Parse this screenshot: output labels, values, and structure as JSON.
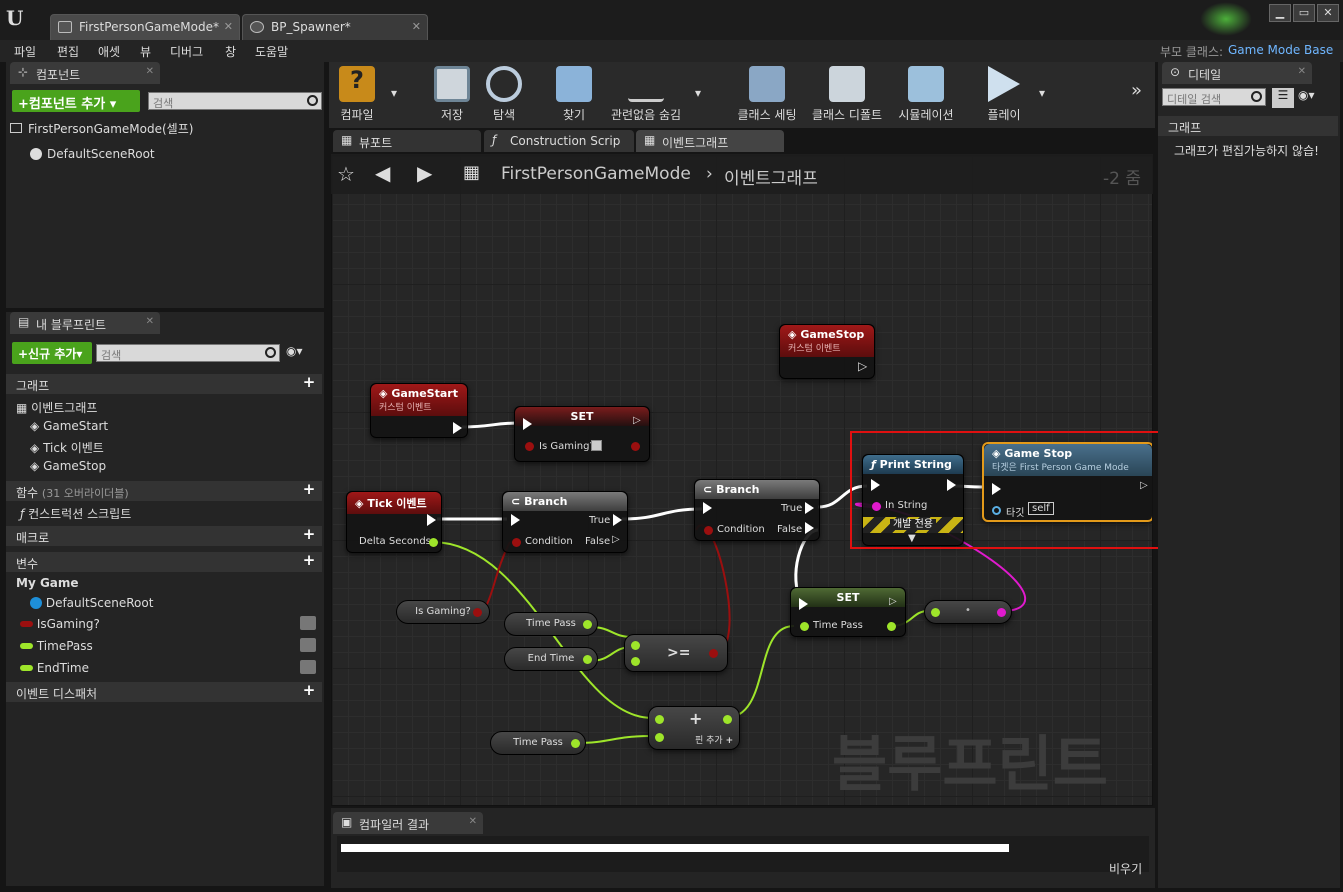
{
  "titlebar": {
    "tabs": [
      "FirstPersonGameMode*",
      "BP_Spawner*"
    ]
  },
  "menu": [
    "파일",
    "편집",
    "애셋",
    "뷰",
    "디버그",
    "창",
    "도움말"
  ],
  "parent_class": {
    "label": "부모 클래스:",
    "value": "Game Mode Base"
  },
  "components": {
    "tab": "컴포넌트",
    "add_button": "+컴포넌트 추가",
    "search_placeholder": "검색",
    "root": "FirstPersonGameMode(셀프)",
    "child": "DefaultSceneRoot"
  },
  "myblueprint": {
    "tab": "내 블루프린트",
    "add_button": "+신규 추가",
    "search_placeholder": "검색",
    "graph_section": "그래프",
    "graph_name": "이벤트그래프",
    "events": [
      "GameStart",
      "Tick 이벤트",
      "GameStop"
    ],
    "functions_section": "함수",
    "functions_count": "(31 오버라이더블)",
    "construction": "컨스트럭션 스크립트",
    "macros": "매크로",
    "variables": "변수",
    "category": "My Game",
    "vars": [
      "DefaultSceneRoot",
      "IsGaming?",
      "TimePass",
      "EndTime"
    ],
    "dispatchers": "이벤트 디스패처"
  },
  "toolbar": [
    "컴파일",
    "저장",
    "탐색",
    "찾기",
    "관련없음 숨김",
    "클래스 세팅",
    "클래스 디폴트",
    "시뮬레이션",
    "플레이"
  ],
  "graphtabs": [
    "뷰포트",
    "Construction Scrip",
    "이벤트그래프"
  ],
  "breadcrumb": {
    "bp": "FirstPersonGameMode",
    "graph": "이벤트그래프",
    "zoom": "-2 줌"
  },
  "nodes": {
    "gamestop_event": {
      "title": "GameStop",
      "sub": "커스텀 이벤트"
    },
    "gamestart_event": {
      "title": "GameStart",
      "sub": "커스텀 이벤트"
    },
    "set1": {
      "title": "SET",
      "pin": "Is Gaming?"
    },
    "tick": {
      "title": "Tick 이벤트",
      "pin": "Delta Seconds"
    },
    "branch1": {
      "title": "Branch",
      "cond": "Condition",
      "t": "True",
      "f": "False"
    },
    "branch2": {
      "title": "Branch",
      "cond": "Condition",
      "t": "True",
      "f": "False"
    },
    "print": {
      "title": "Print String",
      "pin": "In String",
      "dev": "개발 전용"
    },
    "gamestop_call": {
      "title": "Game Stop",
      "sub": "타겟은 First Person Game Mode",
      "target": "타깃",
      "self": "self"
    },
    "isgaming": "Is Gaming?",
    "timepass1": "Time Pass",
    "endtime": "End Time",
    "compare": ">=",
    "set2": {
      "title": "SET",
      "pin": "Time Pass"
    },
    "add": {
      "op": "+",
      "addpin": "핀 추가"
    },
    "timepass2": "Time Pass"
  },
  "watermark": "블루프린트",
  "details": {
    "tab": "디테일",
    "search_placeholder": "디테일 검색",
    "section": "그래프",
    "note": "그래프가 편집가능하지 않습!"
  },
  "compiler": {
    "tab": "컴파일러 결과",
    "clear": "비우기"
  }
}
